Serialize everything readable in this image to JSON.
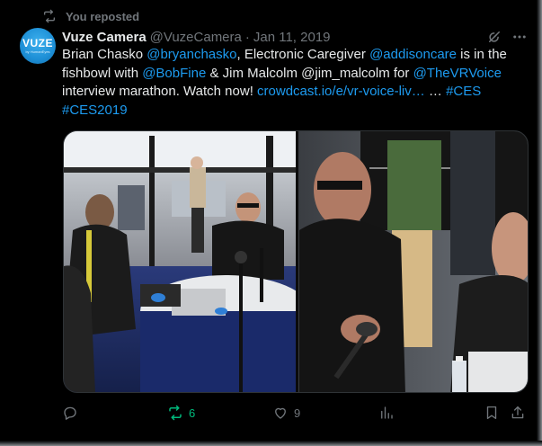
{
  "repost_banner": {
    "text": "You reposted",
    "icon": "repost-icon"
  },
  "tweet": {
    "author_name": "Vuze Camera",
    "author_handle": "@VuzeCamera",
    "separator": "·",
    "date": "Jan 11, 2019",
    "avatar": {
      "logo_text": "VUZE",
      "logo_sub": "by HumanEyes"
    },
    "text_segments": [
      {
        "text": "Brian Chasko ",
        "link": false
      },
      {
        "text": "@bryanchasko",
        "link": true
      },
      {
        "text": ", Electronic Caregiver ",
        "link": false
      },
      {
        "text": "@addisoncare",
        "link": true
      },
      {
        "text": " is in the fishbowl with  ",
        "link": false
      },
      {
        "text": "@BobFine",
        "link": true
      },
      {
        "text": " & Jim Malcolm @jim_malcolm for ",
        "link": false
      },
      {
        "text": "@TheVRVoice",
        "link": true
      },
      {
        "text": " interview marathon. Watch now! ",
        "link": false
      },
      {
        "text": "crowdcast.io/e/vr-voice-liv…",
        "link": true
      },
      {
        "text": " … ",
        "link": false
      },
      {
        "text": "#CES",
        "link": true
      },
      {
        "text": " ",
        "link": false
      },
      {
        "text": "#CES2019",
        "link": true
      }
    ]
  },
  "actions": {
    "reply": {
      "count": "",
      "icon": "reply-icon"
    },
    "repost": {
      "count": "6",
      "icon": "repost-icon",
      "active": true
    },
    "like": {
      "count": "9",
      "icon": "heart-icon"
    },
    "views": {
      "count": "",
      "icon": "views-icon"
    },
    "bookmark": {
      "icon": "bookmark-icon"
    },
    "share": {
      "icon": "share-icon"
    }
  },
  "colors": {
    "background": "#000000",
    "text": "#e7e9ea",
    "muted": "#71767b",
    "link": "#1d9bf0",
    "repost_active": "#00ba7c",
    "avatar": "#1d8fd6"
  }
}
